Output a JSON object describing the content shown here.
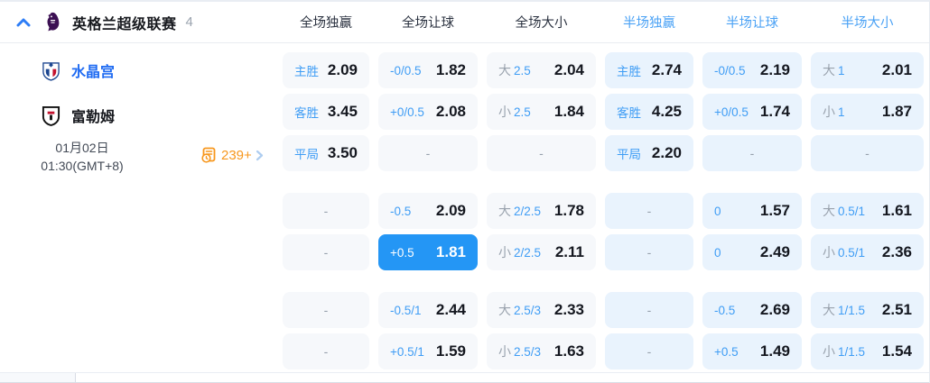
{
  "header": {
    "league": "英格兰超级联赛",
    "match_count": "4",
    "columns": [
      {
        "label": "全场独赢",
        "period": "full"
      },
      {
        "label": "全场让球",
        "period": "full"
      },
      {
        "label": "全场大小",
        "period": "full"
      },
      {
        "label": "半场独赢",
        "period": "half"
      },
      {
        "label": "半场让球",
        "period": "half"
      },
      {
        "label": "半场大小",
        "period": "half"
      }
    ],
    "icons": {
      "collapse": "chevron-up",
      "league_logo": "premier-league-lion"
    }
  },
  "match": {
    "home_team": "水晶宫",
    "away_team": "富勒姆",
    "date": "01月02日",
    "time": "01:30(GMT+8)",
    "more_markets_count": "239+",
    "icons": {
      "markets": "odds-list-clock",
      "more": "chevron-right",
      "home_crest": "crystal-palace-crest",
      "away_crest": "fulham-crest"
    }
  },
  "colors": {
    "accent_blue": "#3f9df5",
    "selected_cell_bg": "#2496f5",
    "half_cell_bg": "#e9f3fd",
    "full_cell_bg": "#f6f8fb",
    "orange": "#f7971d",
    "half_header_text": "#4ba2f5"
  },
  "odds": {
    "dash": "-",
    "groups": [
      {
        "rows": [
          [
            {
              "kind": "pick",
              "label": "主胜",
              "value": "2.09"
            },
            {
              "kind": "hcp",
              "label": "-0/0.5",
              "value": "1.82"
            },
            {
              "kind": "ou",
              "prefix": "大",
              "line": "2.5",
              "value": "2.04"
            },
            {
              "kind": "pick",
              "label": "主胜",
              "value": "2.74"
            },
            {
              "kind": "hcp",
              "label": "-0/0.5",
              "value": "2.19"
            },
            {
              "kind": "ou",
              "prefix": "大",
              "line": "1",
              "value": "2.01"
            }
          ],
          [
            {
              "kind": "pick",
              "label": "客胜",
              "value": "3.45"
            },
            {
              "kind": "hcp",
              "label": "+0/0.5",
              "value": "2.08"
            },
            {
              "kind": "ou",
              "prefix": "小",
              "line": "2.5",
              "value": "1.84"
            },
            {
              "kind": "pick",
              "label": "客胜",
              "value": "4.25"
            },
            {
              "kind": "hcp",
              "label": "+0/0.5",
              "value": "1.74"
            },
            {
              "kind": "ou",
              "prefix": "小",
              "line": "1",
              "value": "1.87"
            }
          ],
          [
            {
              "kind": "pick",
              "label": "平局",
              "value": "3.50"
            },
            {
              "kind": "dash"
            },
            {
              "kind": "dash"
            },
            {
              "kind": "pick",
              "label": "平局",
              "value": "2.20"
            },
            {
              "kind": "dash"
            },
            {
              "kind": "dash"
            }
          ]
        ]
      },
      {
        "rows": [
          [
            {
              "kind": "dash"
            },
            {
              "kind": "hcp",
              "label": "-0.5",
              "value": "2.09"
            },
            {
              "kind": "ou",
              "prefix": "大",
              "line": "2/2.5",
              "value": "1.78"
            },
            {
              "kind": "dash"
            },
            {
              "kind": "hcp",
              "label": "0",
              "value": "1.57"
            },
            {
              "kind": "ou",
              "prefix": "大",
              "line": "0.5/1",
              "value": "1.61"
            }
          ],
          [
            {
              "kind": "dash"
            },
            {
              "kind": "hcp",
              "label": "+0.5",
              "value": "1.81",
              "selected": true
            },
            {
              "kind": "ou",
              "prefix": "小",
              "line": "2/2.5",
              "value": "2.11"
            },
            {
              "kind": "dash"
            },
            {
              "kind": "hcp",
              "label": "0",
              "value": "2.49"
            },
            {
              "kind": "ou",
              "prefix": "小",
              "line": "0.5/1",
              "value": "2.36"
            }
          ]
        ]
      },
      {
        "rows": [
          [
            {
              "kind": "dash"
            },
            {
              "kind": "hcp",
              "label": "-0.5/1",
              "value": "2.44"
            },
            {
              "kind": "ou",
              "prefix": "大",
              "line": "2.5/3",
              "value": "2.33"
            },
            {
              "kind": "dash"
            },
            {
              "kind": "hcp",
              "label": "-0.5",
              "value": "2.69"
            },
            {
              "kind": "ou",
              "prefix": "大",
              "line": "1/1.5",
              "value": "2.51"
            }
          ],
          [
            {
              "kind": "dash"
            },
            {
              "kind": "hcp",
              "label": "+0.5/1",
              "value": "1.59"
            },
            {
              "kind": "ou",
              "prefix": "小",
              "line": "2.5/3",
              "value": "1.63"
            },
            {
              "kind": "dash"
            },
            {
              "kind": "hcp",
              "label": "+0.5",
              "value": "1.49"
            },
            {
              "kind": "ou",
              "prefix": "小",
              "line": "1/1.5",
              "value": "1.54"
            }
          ]
        ]
      }
    ]
  }
}
